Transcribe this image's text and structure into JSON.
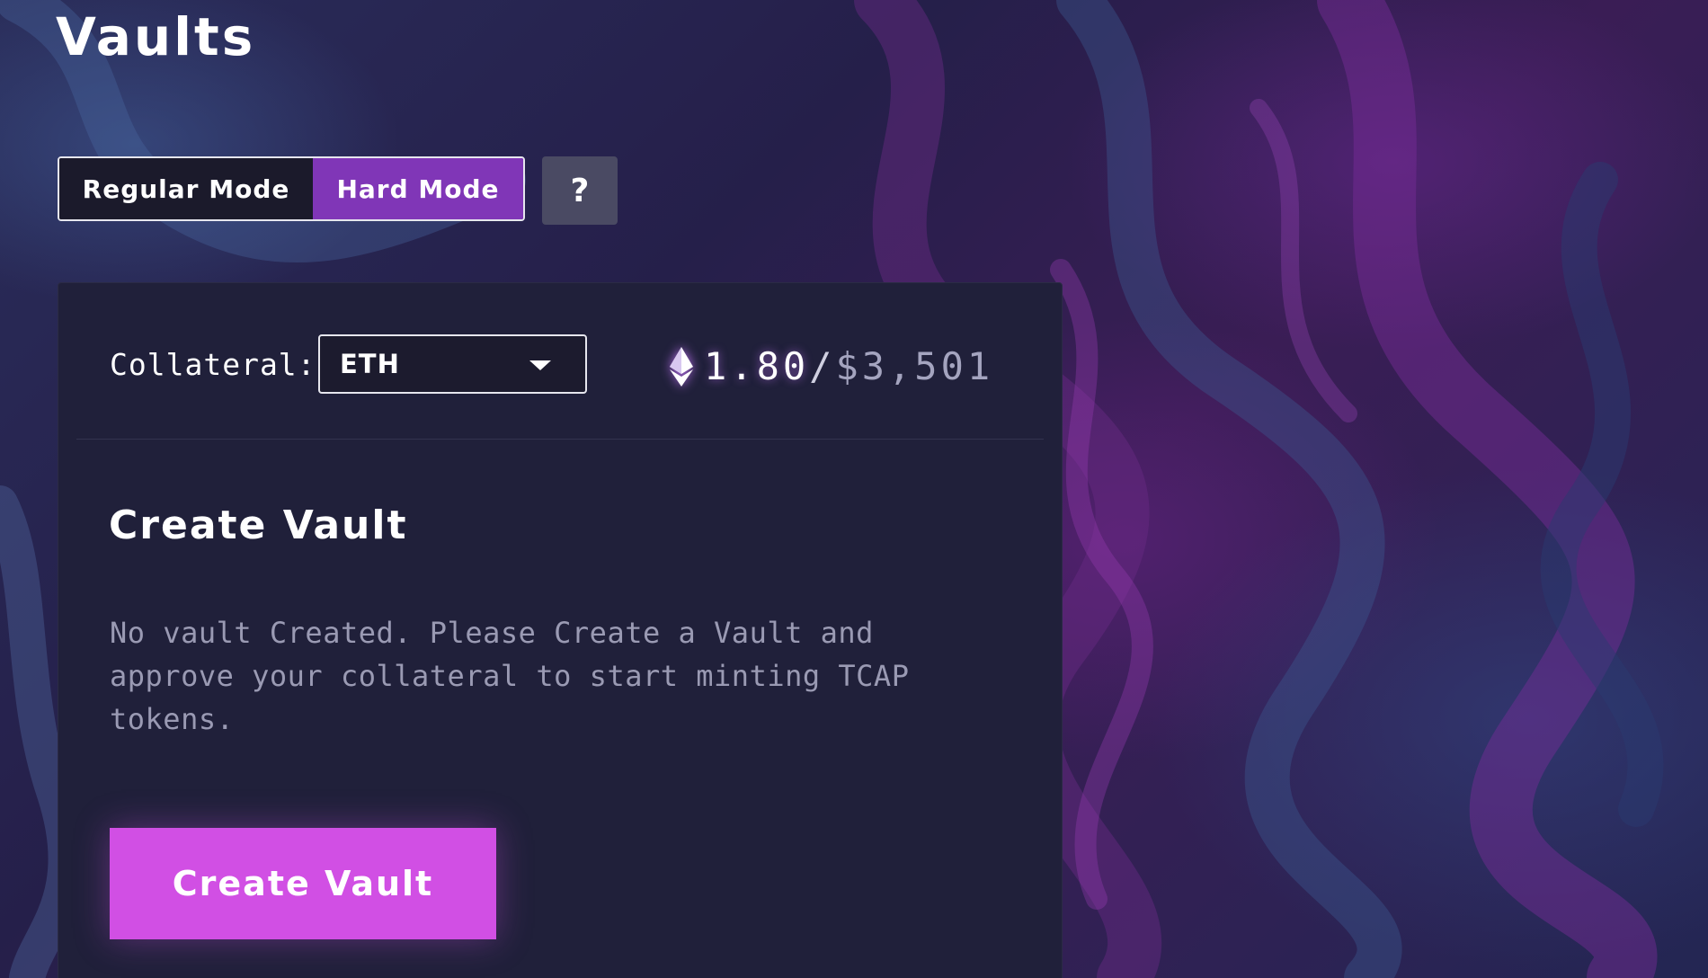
{
  "page": {
    "title": "Vaults"
  },
  "mode_toggle": {
    "regular_label": "Regular Mode",
    "hard_label": "Hard Mode",
    "selected": "Hard Mode"
  },
  "help_button": {
    "label": "?",
    "icon": "question-mark-icon"
  },
  "collateral": {
    "label": "Collateral:",
    "selected": "ETH",
    "icon": "chevron-down-icon"
  },
  "balance": {
    "icon": "ethereum-icon",
    "amount": "1.80",
    "separator": "/",
    "usd": "$3,501"
  },
  "create_section": {
    "title": "Create Vault",
    "description": "No vault Created. Please Create a Vault and approve your collateral to start minting TCAP tokens.",
    "button_label": "Create Vault"
  },
  "colors": {
    "background": "#1e1a3a",
    "card": "#20203a",
    "hard_mode_active": "#8036b7",
    "help_button": "#4a4a63",
    "primary_button": "#d14fe4",
    "text_primary": "#ffffff",
    "text_muted": "#9a9ab3"
  }
}
